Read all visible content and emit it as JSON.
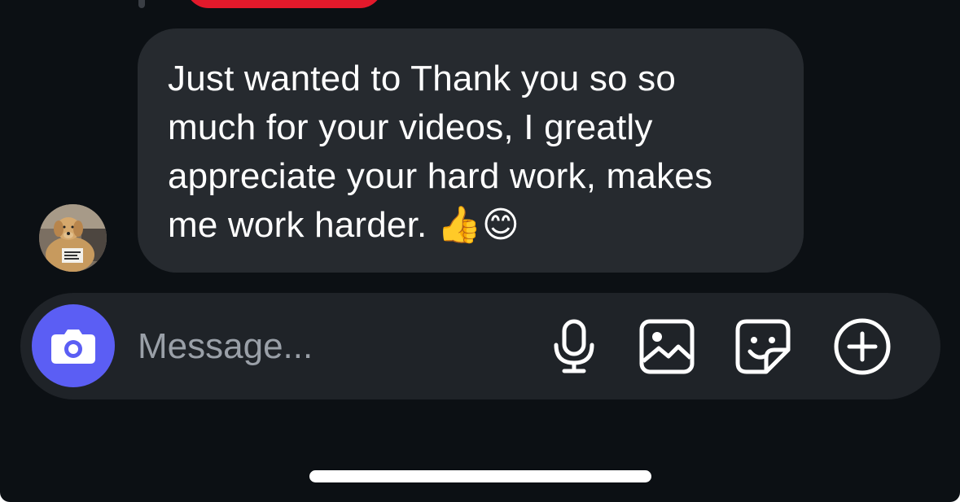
{
  "thread": {
    "incoming_message": {
      "text": "Just wanted to Thank you so so\nmuch for your videos, I greatly\nappreciate your hard work, makes\nme work harder. 👍😊",
      "sender_avatar": "golden-retriever-dog-photo"
    }
  },
  "composer": {
    "placeholder": "Message...",
    "camera_icon": "camera-icon",
    "actions": [
      {
        "name": "microphone-icon"
      },
      {
        "name": "photo-gallery-icon"
      },
      {
        "name": "sticker-icon"
      },
      {
        "name": "plus-circle-icon"
      }
    ]
  },
  "colors": {
    "background": "#0c1014",
    "incoming_bubble": "#262a2f",
    "composer_bg": "#1f2328",
    "camera_button": "#5b5ef4",
    "previous_bubble": "#e3192b"
  }
}
